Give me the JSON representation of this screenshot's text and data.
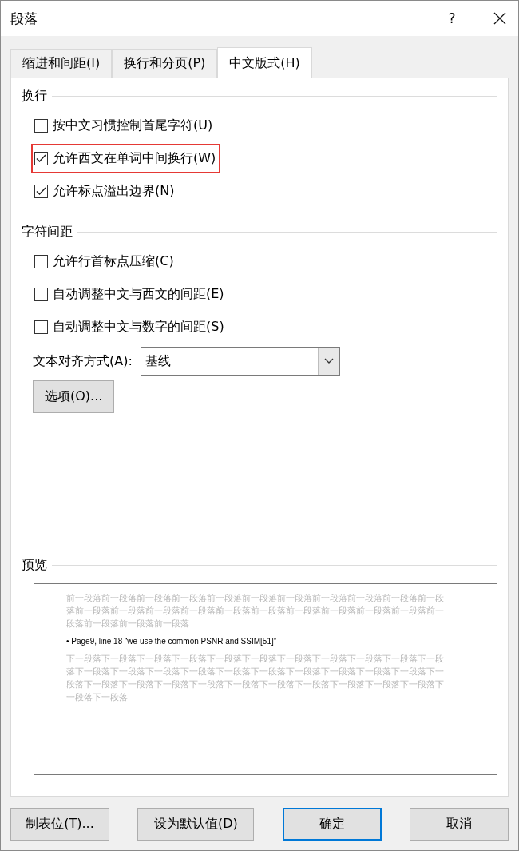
{
  "window": {
    "title": "段落",
    "help": "?"
  },
  "tabs": [
    {
      "label": "缩进和间距(I)",
      "selected": false
    },
    {
      "label": "换行和分页(P)",
      "selected": false
    },
    {
      "label": "中文版式(H)",
      "selected": true
    }
  ],
  "sections": [
    {
      "title": "换行",
      "options": [
        {
          "label": "按中文习惯控制首尾字符(U)",
          "checked": false,
          "highlighted": false
        },
        {
          "label": "允许西文在单词中间换行(W)",
          "checked": true,
          "highlighted": true
        },
        {
          "label": "允许标点溢出边界(N)",
          "checked": true,
          "highlighted": false
        }
      ]
    },
    {
      "title": "字符间距",
      "options": [
        {
          "label": "允许行首标点压缩(C)",
          "checked": false,
          "highlighted": false
        },
        {
          "label": "自动调整中文与西文的间距(E)",
          "checked": false,
          "highlighted": false
        },
        {
          "label": "自动调整中文与数字的间距(S)",
          "checked": false,
          "highlighted": false
        }
      ]
    }
  ],
  "text_alignment": {
    "label": "文本对齐方式(A):",
    "value": "基线"
  },
  "options_button": "选项(O)...",
  "preview": {
    "title": "预览",
    "before_lines": [
      "前一段落前一段落前一段落前一段落前一段落前一段落前一段落前一段落前一段落前一段落前一段",
      "落前一段落前一段落前一段落前一段落前一段落前一段落前一段落前一段落前一段落前一段落前一",
      "段落前一段落前一段落前一段落"
    ],
    "sample": "• Page9, line 18 “we use the common PSNR and SSIM[51]”",
    "after_lines": [
      "下一段落下一段落下一段落下一段落下一段落下一段落下一段落下一段落下一段落下一段落下一段",
      "落下一段落下一段落下一段落下一段落下一段落下一段落下一段落下一段落下一段落下一段落下一",
      "段落下一段落下一段落下一段落下一段落下一段落下一段落下一段落下一段落下一段落下一段落下",
      "一段落下一段落"
    ]
  },
  "buttons": [
    {
      "label": "制表位(T)...",
      "kind": "normal"
    },
    {
      "label": "设为默认值(D)",
      "kind": "normal"
    },
    {
      "label": "确定",
      "kind": "default"
    },
    {
      "label": "取消",
      "kind": "normal"
    }
  ]
}
